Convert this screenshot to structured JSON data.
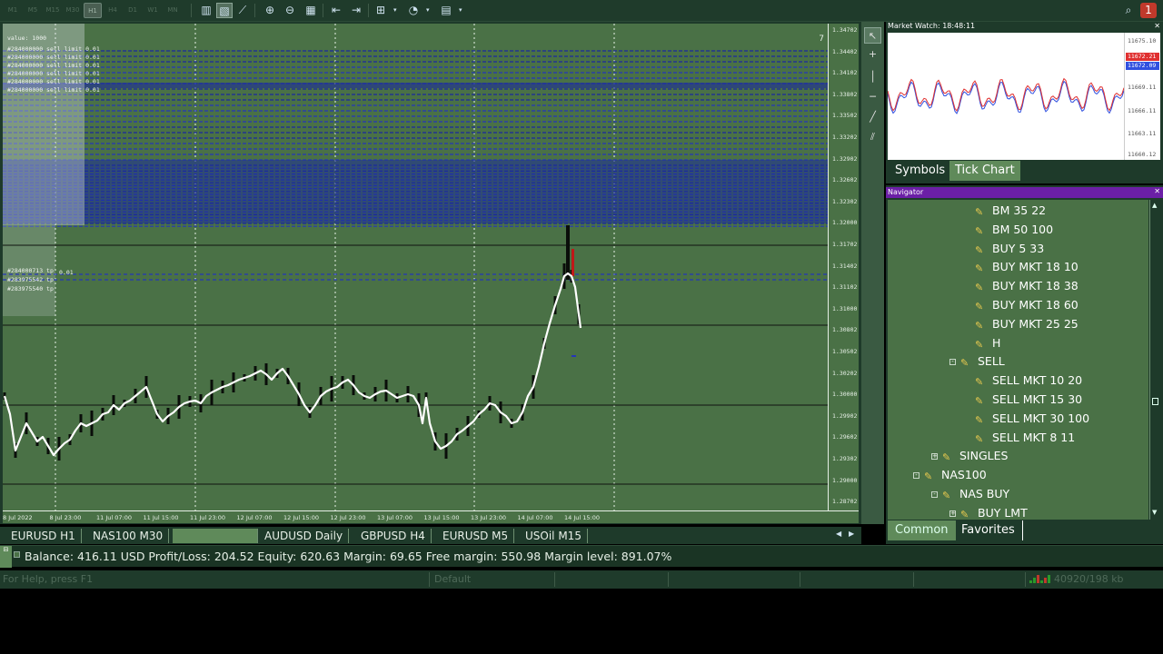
{
  "toolbar": {
    "timeframes": [
      "M1",
      "M5",
      "M15",
      "M30",
      "H1",
      "H4",
      "D1",
      "W1",
      "MN"
    ],
    "active_timeframe": "H1",
    "alert_count": "1"
  },
  "chart": {
    "corner_label": "7",
    "price_labels": [
      "1.34702",
      "1.34402",
      "1.34102",
      "1.33802",
      "1.33502",
      "1.33202",
      "1.32902",
      "1.32602",
      "1.32302",
      "1.32000",
      "1.31702",
      "1.31402",
      "1.31102",
      "1.31000",
      "1.30802",
      "1.30502",
      "1.30202",
      "1.30000",
      "1.29902",
      "1.29602",
      "1.29302",
      "1.29000",
      "1.28702"
    ],
    "time_labels": [
      "8 Jul 2022",
      "8 Jul 23:00",
      "11 Jul 07:00",
      "11 Jul 15:00",
      "11 Jul 23:00",
      "12 Jul 07:00",
      "12 Jul 15:00",
      "12 Jul 23:00",
      "13 Jul 07:00",
      "13 Jul 15:00",
      "13 Jul 23:00",
      "14 Jul 07:00",
      "14 Jul 15:00"
    ],
    "order_labels": [
      "#284000000 sell limit 0.01",
      "#284000000 sell limit 0.01",
      "#284000000 sell limit 0.01",
      "#284000000 sell limit 0.01",
      "#284000000 sell limit 0.01",
      "#284000000 sell limit 0.01",
      "#284000713 tp",
      "#283975542 tp",
      "#283975540 tp"
    ],
    "value_label": "value: 1000",
    "small_label": "0.01"
  },
  "chart_tabs": [
    "EURUSD H1",
    "NAS100 M30",
    "",
    "AUDUSD Daily",
    "GBPUSD H4",
    "EURUSD M5",
    "USOil M15"
  ],
  "market_watch": {
    "title": "Market Watch: 18:48:11",
    "tick_labels": [
      "11675.10",
      "11672.21",
      "11672.09",
      "11669.11",
      "11666.11",
      "11663.11",
      "11660.12"
    ],
    "bid": "11672.21",
    "ask": "11672.09",
    "tabs": [
      "Symbols",
      "Tick Chart"
    ],
    "active_tab": "Tick Chart"
  },
  "navigator": {
    "title": "Navigator",
    "items": [
      {
        "label": "BM 35 22",
        "level": 3
      },
      {
        "label": "BM 50 100",
        "level": 3
      },
      {
        "label": "BUY  5 33",
        "level": 3
      },
      {
        "label": "BUY MKT 18 10",
        "level": 3
      },
      {
        "label": "BUY MKT 18 38",
        "level": 3
      },
      {
        "label": "BUY MKT 18 60",
        "level": 3
      },
      {
        "label": "BUY MKT 25 25",
        "level": 3
      },
      {
        "label": "H",
        "level": 3
      },
      {
        "label": "SELL",
        "level": 2,
        "toggle": "-"
      },
      {
        "label": "SELL MKT 10 20",
        "level": 3
      },
      {
        "label": "SELL MKT 15 30",
        "level": 3
      },
      {
        "label": "SELL MKT 30 100",
        "level": 3
      },
      {
        "label": "SELL MKT 8 11",
        "level": 3
      },
      {
        "label": "SINGLES",
        "level": 1,
        "toggle": "+"
      },
      {
        "label": "NAS100",
        "level": 0,
        "toggle": "-"
      },
      {
        "label": "NAS BUY",
        "level": 1,
        "toggle": "-"
      },
      {
        "label": "BUY LMT",
        "level": 2,
        "toggle": "+"
      }
    ],
    "tabs": [
      "Common",
      "Favorites"
    ],
    "active_tab": "Common"
  },
  "terminal": {
    "text": "Balance: 416.11 USD   Profit/Loss: 204.52   Equity: 620.63   Margin: 69.65   Free margin: 550.98   Margin level: 891.07%"
  },
  "statusbar": {
    "help": "For Help, press F1",
    "profile": "Default",
    "traffic": "40920/198 kb"
  }
}
